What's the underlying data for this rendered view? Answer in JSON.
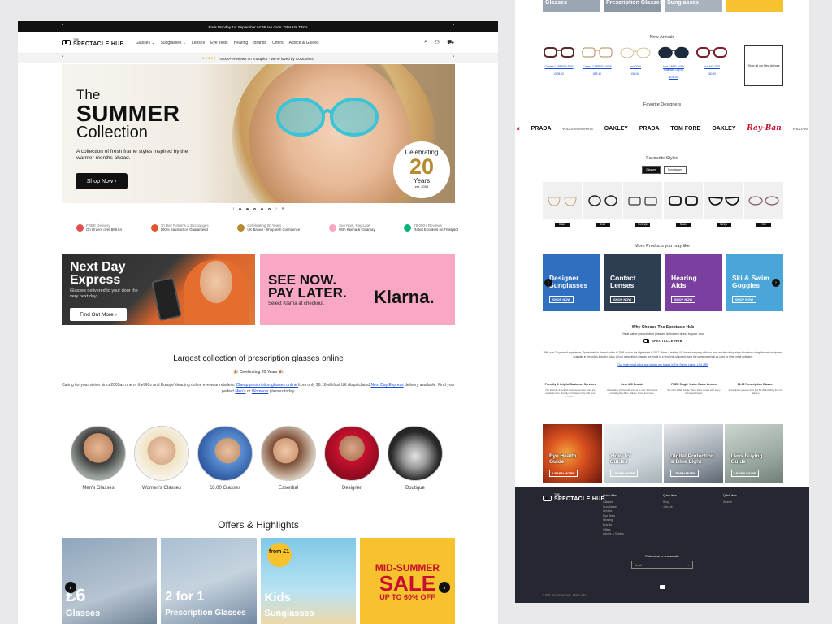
{
  "promo": {
    "text": "Ends Monday 1st September 04:38Use code: TINA93s T&Cs"
  },
  "brand": {
    "name": "SPECTACLE HUB",
    "prefix": "THE"
  },
  "nav": {
    "links": [
      "Glasses ⌄",
      "Sunglasses ⌄",
      "Lenses",
      "Eye Tests",
      "Hearing",
      "Brands",
      "Offers",
      "Advice & Guides"
    ]
  },
  "trust_top": {
    "stars": "★★★★★",
    "text": "75,000+ Reviews on Trustpilot - We're loved by Customers!"
  },
  "hero": {
    "line1": "The",
    "line2": "SUMMER",
    "line3": "Collection",
    "desc": "A collection of fresh frame styles inspired by the warmer months ahead.",
    "button": "Shop Now ›",
    "badge_top": "Celebrating",
    "badge_num": "20",
    "badge_bottom": "Years",
    "badge_est": "est. 2005"
  },
  "usps": [
    {
      "t1": "FREE Delivery",
      "t2": "On Orders over $68.64",
      "color": "#e04d4d"
    },
    {
      "t1": "30 Day Returns & Exchanges",
      "t2": "100% Satisfaction Guaranteed",
      "color": "#e0552b"
    },
    {
      "t1": "Celebrating 20 Years",
      "t2": "UK Based - Shop with Confidence",
      "color": "#b58a30"
    },
    {
      "t1": "See Now, Pay Later",
      "t2": "With Klarna & Clearpay",
      "color": "#f8a8c4"
    },
    {
      "t1": "75,000+ Reviews",
      "t2": "Rated Excellent on Trustpilot",
      "color": "#00b67a"
    }
  ],
  "banner_express": {
    "title1": "Next Day",
    "title2": "Express",
    "desc": "Glasses delivered to your door the very next day!",
    "button": "Find Out More ›"
  },
  "banner_klarna": {
    "title1": "SEE NOW.",
    "title2": "PAY LATER.",
    "desc": "Select Klarna at checkout.",
    "brand": "Klarna."
  },
  "collection": {
    "title": "Largest collection of prescription glasses online",
    "celebrating": "🎉 Celebrating 20 Years 🎉",
    "desc_a": "Caring for your vision since2005as one of theUK's and Europe'sleading online eyewear retailers.",
    "link1": "Cheap prescription glasses online ",
    "desc_b": "from only $6.16withfast UK dispatchand",
    "link2": "Next Day Express",
    "desc_c": "delivery available. Find your perfect",
    "link3": "Men's",
    "desc_d": "or",
    "link4": "Women's",
    "desc_e": "glasses today."
  },
  "categories": [
    {
      "label": "Men's Glasses"
    },
    {
      "label": "Women's Glasses"
    },
    {
      "label": "£6.00 Glasses"
    },
    {
      "label": "Essential"
    },
    {
      "label": "Designer"
    },
    {
      "label": "Boutique"
    }
  ],
  "offers": {
    "title": "Offers & Highlights",
    "items": [
      {
        "big": "£6",
        "small": "Glasses"
      },
      {
        "big": "2 for 1",
        "small": "Prescription Glasses"
      },
      {
        "big": "Kids",
        "small": "Sunglasses",
        "badge": "from £1"
      },
      {
        "l1": "MID-SUMMER",
        "l2": "SALE",
        "l3": "UP TO 60% OFF"
      }
    ]
  },
  "right": {
    "top_tiles": [
      "Glasses",
      "Prescription Glasses",
      "Sunglasses",
      ""
    ],
    "new_arrivals": {
      "title": "New Arrivals",
      "items": [
        {
          "name": "Carrera CARRERA 8053",
          "price": "£108.40"
        },
        {
          "name": "Carrera CARRERA 8055",
          "price": "$98.40"
        },
        {
          "name": "Icon 2060",
          "price": "£60.50"
        },
        {
          "name": "Icon 4 8880 - With Polarised Clip on",
          "price": "$108.80"
        },
        {
          "name": "Icon MD 3178",
          "price": "£60.50"
        }
      ],
      "shop_all": "Shop all our New Arrivals"
    },
    "designers": {
      "title": "Favorite Designers",
      "items": [
        "a",
        "PRADA",
        "WILLIAM MORRIS",
        "OAKLEY",
        "PRADA",
        "TOM FORD",
        "OAKLEY",
        "Ray-Ban",
        "WILLIAM"
      ]
    },
    "favourite": {
      "title": "Favourite Styles",
      "tabs": [
        "Glasses",
        "Sunglasses"
      ],
      "tags": [
        "Aviator",
        "Round",
        "Rectangle",
        "Square",
        "Cat Eye",
        "Oval"
      ]
    },
    "more_products": {
      "title": "More Products you may like",
      "items": [
        {
          "l1": "Designer",
          "l2": "Sunglasses",
          "btn": "SHOP NOW"
        },
        {
          "l1": "Contact",
          "l2": "Lenses",
          "btn": "SHOP NOW"
        },
        {
          "l1": "Hearing",
          "l2": "Aids",
          "btn": "SHOP NOW"
        },
        {
          "l1": "Ski & Swim",
          "l2": "Goggles",
          "btn": "SHOP NOW"
        }
      ]
    },
    "why": {
      "title": "Why Choose The Spectacle Hub",
      "sub": "Great value prescription glasses delivered direct to your door",
      "para": "With over 20 years of experience, SpectacleHub started online in 2005 and on the high street in 2012. We're a leading UK-based company with our own on-site cutting-edge laboratory using the best equipment available in the optics industry today. All our prescription glasses are made to a very high standard using the same materials as used by other retail opticians.",
      "link": "Our main head office and offices are based in The Sorby, Leeds, LS4 2RE",
      "cols": [
        {
          "h": "Friendly & Helpful Customer Services",
          "p": "Our Friendly & Helpful customer service team are available from Monday to Friday to help with your enquiries."
        },
        {
          "h": "Over 400 Brands",
          "p": "Unbeatable choice with access to over 400 brands including Ray-Ban, Oakley, Gucci and more."
        },
        {
          "h": "FREE Single Vision Basic Lenses",
          "p": "We offer FREE Single Vision basic lenses with every frame purchased."
        },
        {
          "h": "$1.36 Prescription Glasses",
          "p": "Prescription glasses from just $1.36 including free UK delivery."
        }
      ]
    },
    "guides": [
      {
        "l1": "Eye Health",
        "l2": "Guide",
        "btn": "LEARN MORE"
      },
      {
        "l1": "'How To'",
        "l2": "Guides",
        "btn": "LEARN MORE"
      },
      {
        "l1": "Digital Protection",
        "l2": "& Blue Light",
        "btn": "LEARN MORE"
      },
      {
        "l1": "Lens Buying",
        "l2": "Guide",
        "btn": "LEARN MORE"
      }
    ],
    "footer": {
      "col1": {
        "h": "Quick links",
        "items": [
          "Glasses",
          "Sunglasses",
          "Lenses",
          "Eye Tests",
          "Hearing",
          "Brands",
          "Offers",
          "Advice & Guides"
        ]
      },
      "col2": {
        "h": "Quick links",
        "items": [
          "Shop",
          "Join Us"
        ]
      },
      "col3": {
        "h": "Quick links",
        "items": [
          "Search"
        ]
      },
      "subscribe": "Subscribe to our emails",
      "email_placeholder": "Email",
      "copyright": "© 2025, The Spectacle Hub · Privacy policy"
    }
  }
}
